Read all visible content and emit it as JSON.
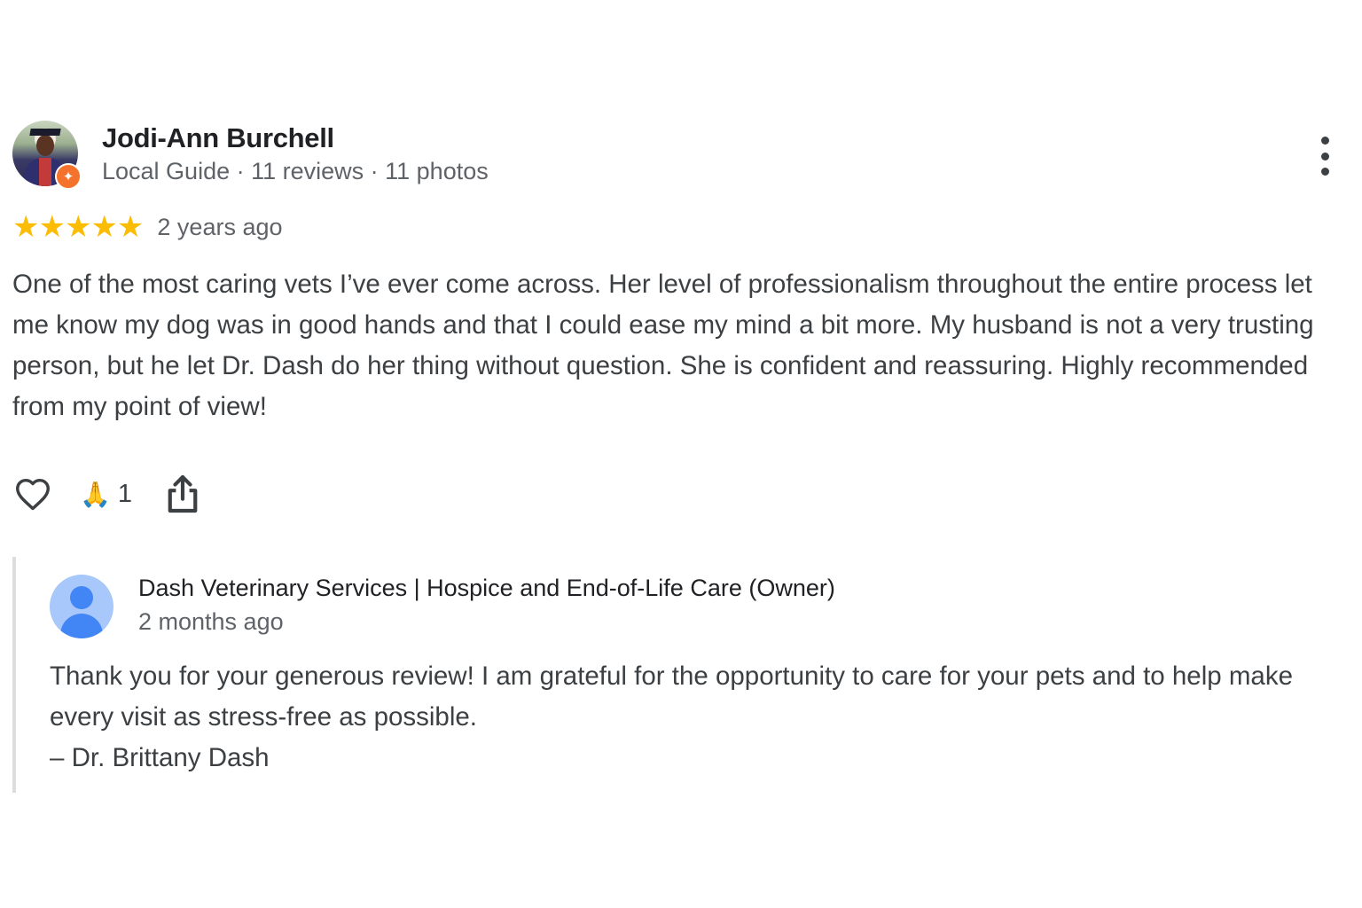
{
  "review": {
    "reviewer_name": "Jodi-Ann Burchell",
    "reviewer_meta": "Local Guide · 11 reviews · 11 photos",
    "avatar_icon": "profile-photo",
    "badge_icon": "local-guide-star-icon",
    "rating": 5,
    "rating_max": 5,
    "stars": "★★★★★",
    "star_color": "#fbbc04",
    "date": "2 years ago",
    "text": "One of the most caring vets I’ve ever come across. Her level of professionalism throughout the entire process let me know my dog was in good hands and that I could ease my mind a bit more. My husband is not a very trusting person, but he let Dr. Dash do her thing without question. She is confident and reassuring. Highly recommended from my point of view!"
  },
  "actions": {
    "like_icon": "heart-outline-icon",
    "reaction_emoji": "🙏",
    "reaction_count": "1",
    "share_icon": "share-icon"
  },
  "owner_response": {
    "name": "Dash Veterinary Services | Hospice and End-of-Life Care (Owner)",
    "date": "2 months ago",
    "avatar_icon": "default-user-icon",
    "avatar_color": "#a8c7fa",
    "text_line1": "Thank you for your generous review! I am grateful for the opportunity to care for your pets and to help make every visit as stress-free as possible.",
    "text_line2": "– Dr. Brittany Dash"
  }
}
